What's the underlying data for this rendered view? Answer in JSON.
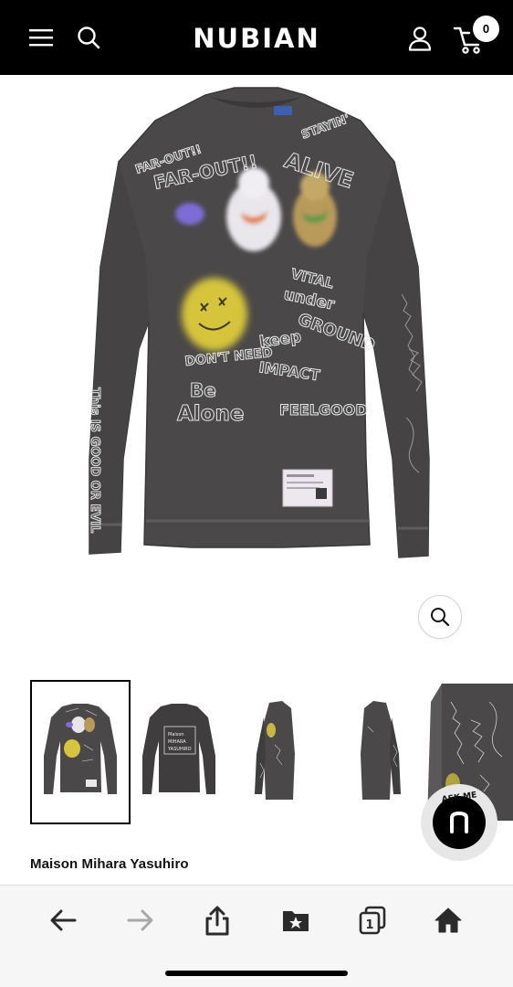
{
  "header": {
    "logo": "NUBIAN",
    "cart_count": "0",
    "icons": [
      "menu-icon",
      "search-icon",
      "account-icon",
      "cart-icon"
    ]
  },
  "product": {
    "brand": "Maison Mihara Yasuhiro",
    "shirt_text": {
      "far_out_small": "FAR-OUT!!",
      "far_out": "FAR-OUT!!",
      "stayin": "STAYIN'",
      "alive": "ALIVE",
      "vital": "VITAL",
      "under": "under",
      "ground": "GROUND",
      "keep": "keep",
      "impact": "IMPACT",
      "feel_good": "FEELGOOD",
      "dont_need": "DON'T NEED",
      "be": "Be",
      "alone": "Alone",
      "sleeve_left": "This IS GOOD OR EVIL",
      "far_out_sticker": "FAR-OUT!"
    }
  },
  "gallery": {
    "selected_index": 0,
    "back_print": [
      "Maison",
      "MIHARA",
      "YASUHIRO"
    ]
  },
  "chat": {
    "label": "ASK ME",
    "icon": "nubian-n-icon"
  },
  "toolbar": {
    "tabs_count": "1",
    "icons": [
      "back-arrow-icon",
      "forward-arrow-icon",
      "share-icon",
      "bookmarks-icon",
      "tabs-icon",
      "home-icon"
    ]
  },
  "colors": {
    "header_bg": "#000000",
    "shirt": "#4a4848",
    "toolbar_bg": "#f6f6f6"
  }
}
